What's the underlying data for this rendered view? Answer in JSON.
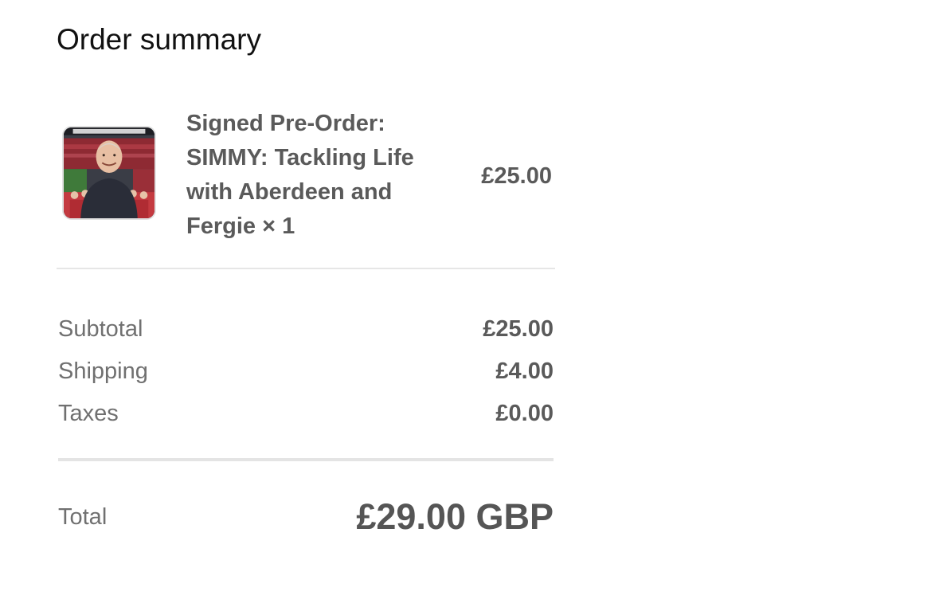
{
  "header": {
    "title": "Order summary"
  },
  "product": {
    "name": "Signed Pre-Order: SIMMY: Tackling Life with Aberdeen and Fergie × 1",
    "price": "£25.00",
    "image": "book-cover-thumbnail"
  },
  "totals": [
    {
      "label": "Subtotal",
      "value": "£25.00"
    },
    {
      "label": "Shipping",
      "value": "£4.00"
    },
    {
      "label": "Taxes",
      "value": "£0.00"
    }
  ],
  "grand_total": {
    "label": "Total",
    "value": "£29.00 GBP"
  }
}
